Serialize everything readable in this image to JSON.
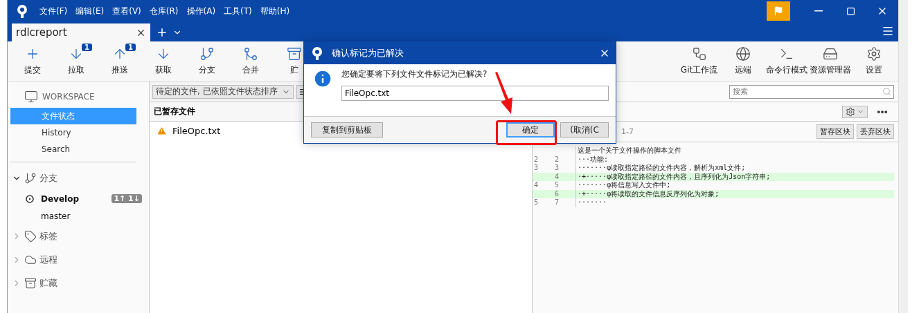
{
  "window": {
    "menus": [
      "文件(F)",
      "编辑(E)",
      "查看(V)",
      "仓库(R)",
      "操作(A)",
      "工具(T)",
      "帮助(H)"
    ]
  },
  "tabs": [
    {
      "label": "rdlcreport",
      "selected": true
    }
  ],
  "toolbar": {
    "left": [
      {
        "kind": "commit",
        "label": "提交"
      },
      {
        "kind": "pull",
        "label": "拉取",
        "badge": "1"
      },
      {
        "kind": "push",
        "label": "推送",
        "badge": "1"
      },
      {
        "kind": "fetch",
        "label": "获取"
      },
      {
        "kind": "branch",
        "label": "分支"
      },
      {
        "kind": "merge",
        "label": "合并"
      },
      {
        "kind": "stash",
        "label": "贮"
      }
    ],
    "right": [
      {
        "kind": "flow",
        "label": "Git工作流"
      },
      {
        "kind": "remote",
        "label": "远端"
      },
      {
        "kind": "terminal",
        "label": "命令行模式"
      },
      {
        "kind": "explorer",
        "label": "资源管理器"
      },
      {
        "kind": "settings",
        "label": "设置"
      }
    ]
  },
  "sidebar": {
    "workspace": {
      "title": "WORKSPACE",
      "items": [
        {
          "label": "文件状态",
          "selected": true
        },
        {
          "label": "History",
          "selected": false
        },
        {
          "label": "Search",
          "selected": false
        }
      ]
    },
    "groups": [
      {
        "kind": "branch",
        "label": "分支",
        "expanded": true,
        "children": [
          {
            "label": "Develop",
            "current": true,
            "badge": "1↑ 1↓"
          },
          {
            "label": "master",
            "current": false
          }
        ]
      },
      {
        "kind": "tag",
        "label": "标签",
        "expanded": false
      },
      {
        "kind": "remote",
        "label": "远程",
        "expanded": false
      },
      {
        "kind": "stash",
        "label": "贮藏",
        "expanded": false
      }
    ]
  },
  "files": {
    "filter": "待定的文件, 已依照文件状态排序",
    "header": "已暂存文件",
    "items": [
      {
        "name": "FileOpc.txt",
        "conflict": true
      }
    ]
  },
  "diff": {
    "search_placeholder": "搜索",
    "hunk": "1-7",
    "buttons": [
      "暂存区块",
      "丢弃区块"
    ],
    "lines": [
      {
        "kind": "context",
        "text": "这是一个关于文件操作的脚本文件"
      },
      {
        "kind": "context",
        "old": "2",
        "new": "2",
        "text": "···功能:"
      },
      {
        "kind": "context",
        "old": "3",
        "new": "3",
        "text": "·······φ读取指定路径的文件内容，解析为xml文件;"
      },
      {
        "kind": "added",
        "new": "4",
        "text": "·+·····φ读取指定路径的文件内容，且序列化为Json字符串;"
      },
      {
        "kind": "context",
        "old": "4",
        "new": "5",
        "text": "·······φ将信息写入文件中;"
      },
      {
        "kind": "added",
        "new": "6",
        "text": "·+·····φ将读取的文件信息反序列化为对象;"
      },
      {
        "kind": "context",
        "old": "5",
        "new": "7",
        "text": "·······"
      }
    ]
  },
  "dialog": {
    "title": "确认标记为已解决",
    "message": "您确定要将下列文件文件标记为已解决?",
    "field_value": "FileOpc.txt",
    "buttons": [
      {
        "label": "复制到剪贴板",
        "kind": "secondary",
        "default": false
      },
      {
        "label": "确定",
        "kind": "primary",
        "default": true
      },
      {
        "label": "(取消(C",
        "kind": "primary",
        "default": false
      }
    ]
  }
}
